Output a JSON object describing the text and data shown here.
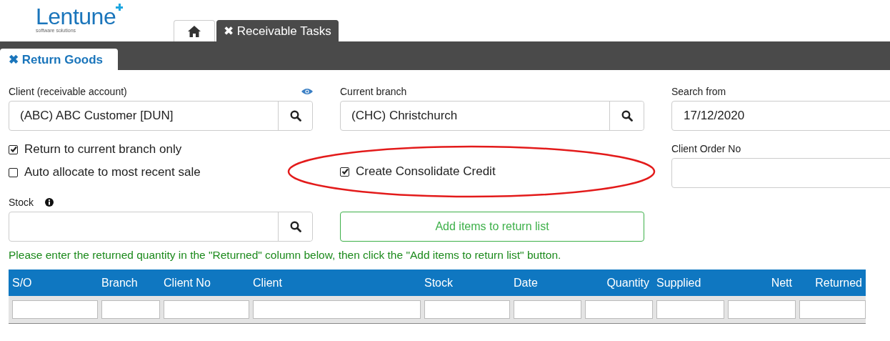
{
  "logo": {
    "name": "Lentune",
    "tagline": "software solutions"
  },
  "top_tabs": [
    {
      "kind": "home",
      "selected": false
    },
    {
      "kind": "text",
      "label": "Receivable Tasks",
      "close": "✖",
      "selected": true
    }
  ],
  "sub_tabs": [
    {
      "label": "Return Goods",
      "close": "✖",
      "selected": true
    }
  ],
  "client": {
    "label": "Client (receivable account)",
    "value": "(ABC) ABC Customer [DUN]"
  },
  "branch": {
    "label": "Current branch",
    "value": "(CHC) Christchurch"
  },
  "search_from": {
    "label": "Search from",
    "value": "17/12/2020"
  },
  "client_order": {
    "label": "Client Order No"
  },
  "left_options": [
    {
      "label": "Return to current branch only",
      "checked": true
    },
    {
      "label": "Auto allocate to most recent sale",
      "checked": false
    }
  ],
  "consolidate_option": {
    "label": "Create Consolidate Credit",
    "checked": true,
    "circled": true
  },
  "stock": {
    "label": "Stock"
  },
  "add_button": "Add items to return list",
  "instruction": "Please enter the returned quantity in the \"Returned\" column below, then click the \"Add items to return list\" button.",
  "table": {
    "columns": [
      "S/O",
      "Branch",
      "Client No",
      "Client",
      "Stock",
      "Date",
      "Quantity",
      "Supplied",
      "Nett",
      "Returned"
    ]
  }
}
